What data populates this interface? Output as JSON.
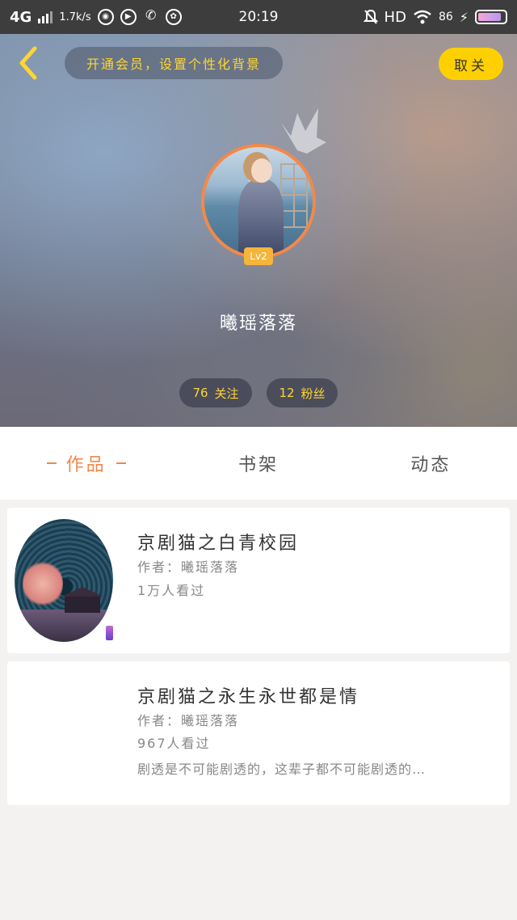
{
  "status_bar": {
    "network": "4G",
    "speed": "1.7k/s",
    "time": "20:19",
    "hd": "HD",
    "battery": "86",
    "battery_level": 0.86
  },
  "header": {
    "vip_prompt": "开通会员，设置个性化背景",
    "unfollow_label": "取关",
    "level": "Lv2",
    "username": "曦瑶落落",
    "following_count": "76",
    "following_label": "关注",
    "fans_count": "12",
    "fans_label": "粉丝",
    "colors": {
      "accent_yellow": "#ffd000",
      "avatar_border": "#f2894a",
      "active_tab": "#f0884a"
    }
  },
  "tabs": [
    {
      "label": "作品",
      "active": true
    },
    {
      "label": "书架",
      "active": false
    },
    {
      "label": "动态",
      "active": false
    }
  ],
  "works": [
    {
      "title": "京剧猫之白青校园",
      "author": "作者：曦瑶落落",
      "views": "1万人看过",
      "has_cover": true
    },
    {
      "title": "京剧猫之永生永世都是情",
      "author": "作者：曦瑶落落",
      "views": "967人看过",
      "description": "剧透是不可能剧透的，这辈子都不可能剧透的…",
      "has_cover": false
    }
  ]
}
